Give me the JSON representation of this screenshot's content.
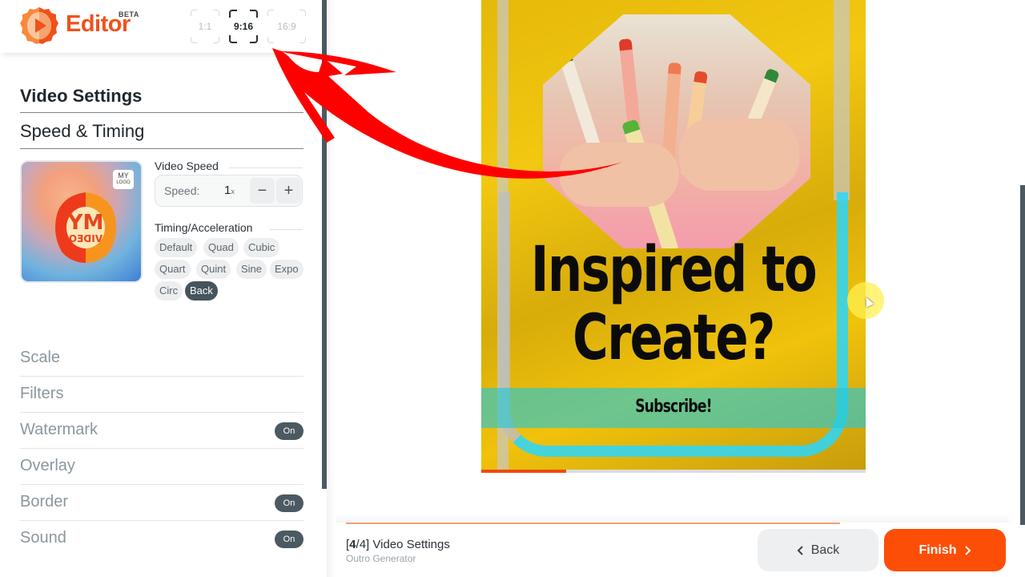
{
  "app": {
    "brand": "Editor",
    "beta_badge": "BETA",
    "logo_icon": "lion-play-logo-icon"
  },
  "aspect_ratios": [
    {
      "label": "1:1",
      "selected": false
    },
    {
      "label": "9:16",
      "selected": true
    },
    {
      "label": "16:9",
      "selected": false
    }
  ],
  "sidebar": {
    "section_title": "Video Settings",
    "subsection_title": "Speed & Timing",
    "thumbnail": {
      "badge_top": "MY",
      "badge_bottom": "LOGO",
      "logo_text_top": "MY",
      "logo_text_bottom": "VIDEO"
    },
    "video_speed": {
      "label": "Video Speed",
      "key": "Speed:",
      "value": "1",
      "unit": "x",
      "decrement": "−",
      "increment": "+"
    },
    "timing": {
      "label": "Timing/Acceleration",
      "options": [
        "Default",
        "Quad",
        "Cubic",
        "Quart",
        "Quint",
        "Sine",
        "Expo",
        "Circ",
        "Back"
      ],
      "selected": "Back"
    },
    "accordion": [
      {
        "label": "Scale",
        "toggle": null
      },
      {
        "label": "Filters",
        "toggle": null
      },
      {
        "label": "Watermark",
        "toggle": "On"
      },
      {
        "label": "Overlay",
        "toggle": null
      },
      {
        "label": "Border",
        "toggle": "On"
      },
      {
        "label": "Sound",
        "toggle": "On"
      }
    ]
  },
  "preview": {
    "headline_line1": "Inspired to",
    "headline_line2": "Create?",
    "subscribe": "Subscribe!",
    "playback_progress": 0.22
  },
  "footer": {
    "step_current": "4",
    "step_total": "4",
    "step_title": "Video Settings",
    "step_subtitle": "Outro Generator",
    "step_progress": 0.75,
    "back_label": "Back",
    "finish_label": "Finish",
    "back_icon": "chevron-left-icon",
    "finish_icon": "chevron-right-icon"
  },
  "colors": {
    "brand": "#f0511d",
    "finish": "#fd4e08",
    "toggle_on": "#4b5a62",
    "chip_active": "#45545d",
    "annotation_arrow": "#ff0000"
  }
}
